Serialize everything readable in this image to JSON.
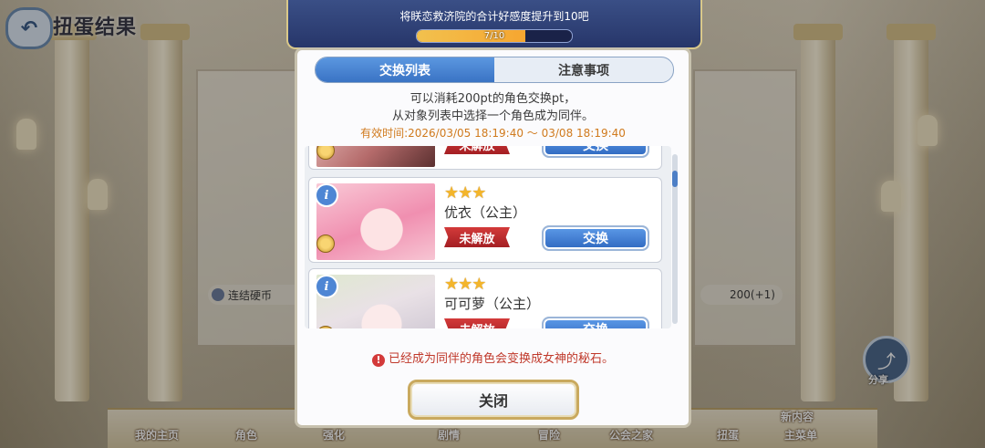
{
  "screen": {
    "title": "扭蛋结果"
  },
  "affection": {
    "text": "将眹恋救济院的合计好感度提升到10吧",
    "progress_label": "7/10",
    "progress": 0.7
  },
  "dialog": {
    "tabs": [
      {
        "label": "交换列表",
        "active": true
      },
      {
        "label": "注意事项",
        "active": false
      }
    ],
    "description": [
      "可以消耗200pt的角色交换pt，",
      "从对象列表中选择一个角色成为同伴。"
    ],
    "validity": "有效时间:2026/03/05 18:19:40 ～ 03/08 18:19:40",
    "characters": [
      {
        "name": "",
        "stars": "★★★",
        "status": "未解放",
        "button": "交换"
      },
      {
        "name": "优衣（公主）",
        "stars": "★★★",
        "status": "未解放",
        "button": "交换"
      },
      {
        "name": "可可萝（公主）",
        "stars": "★★★",
        "status": "未解放",
        "button": "交换"
      }
    ],
    "warning_icon": "!",
    "warning": "已经成为同伴的角色会变换成女神的秘石。",
    "close_label": "关闭"
  },
  "background": {
    "coin_label": "连结硬币",
    "coin_count": "200(+1)",
    "share_label": "分享",
    "share_icon": "share-icon",
    "nav": [
      "我的主页",
      "角色",
      "强化",
      "剧情",
      "冒险",
      "公会之家",
      "扭蛋",
      "主菜单"
    ],
    "nav_new": "新内容"
  },
  "colors": {
    "accent": "#3a73c4",
    "warning": "#c0392b",
    "validity": "#d07a1d",
    "locked": "#b3262b"
  }
}
